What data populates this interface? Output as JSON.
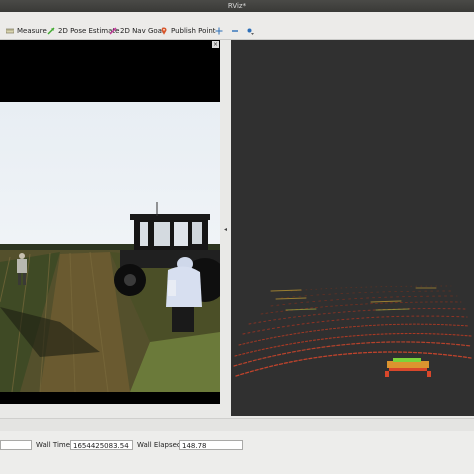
{
  "window": {
    "title": "RViz*"
  },
  "toolbar": {
    "tools": [
      {
        "label": "Measure",
        "icon": "ruler-icon"
      },
      {
        "label": "2D Pose Estimate",
        "icon": "green-arrow-icon"
      },
      {
        "label": "2D Nav Goal",
        "icon": "pink-arrow-icon"
      },
      {
        "label": "Publish Point",
        "icon": "map-pin-icon"
      }
    ],
    "extra_icons": [
      "move-camera-icon",
      "zoom-out-icon",
      "view-options-icon"
    ]
  },
  "panels": {
    "left": {
      "content": "camera-image",
      "close_symbol": "×"
    },
    "right": {
      "content": "point-cloud-3d-view"
    },
    "splitter_symbol": "◂"
  },
  "timebar": {
    "ros_time_value": "",
    "wall_time_label": "Wall Time:",
    "wall_time_value": "1654425083.54",
    "wall_elapsed_label": "Wall Elapsed:",
    "wall_elapsed_value": "148.78"
  },
  "colors": {
    "titlebar": "#3f3f3c",
    "viewport_bg": "#303030",
    "cloud_red": "#d9472b",
    "cloud_green": "#7cd33a",
    "cloud_orange": "#f0a030"
  }
}
